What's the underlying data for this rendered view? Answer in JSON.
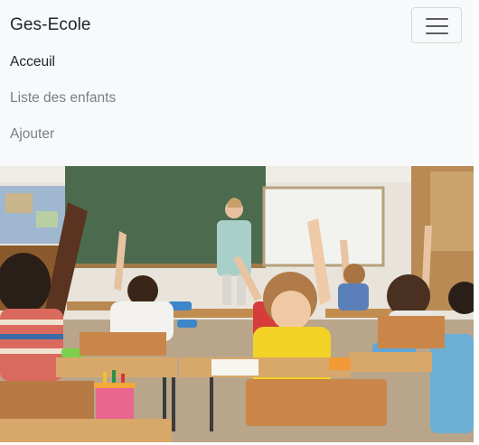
{
  "navbar": {
    "brand": "Ges-Ecole",
    "toggler_icon": "hamburger-menu-icon",
    "links": [
      {
        "label": "Acceuil",
        "active": true
      },
      {
        "label": "Liste des enfants",
        "active": false
      },
      {
        "label": "Ajouter",
        "active": false
      }
    ]
  },
  "hero": {
    "image": "classroom-photo",
    "colors": {
      "wall": "#e9e5de",
      "chalkboard": "#4c6b4e",
      "whiteboard": "#f2f3ee",
      "desk": "#c79352",
      "yellow_shirt": "#f3d226"
    }
  }
}
